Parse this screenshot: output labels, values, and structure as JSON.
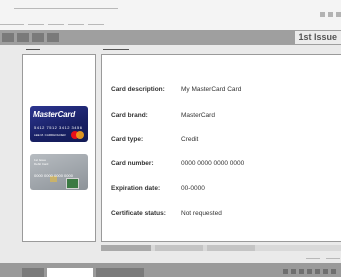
{
  "window": {
    "tab_label": "1st Issue"
  },
  "cards": [
    {
      "brand_logo_text": "MasterCard",
      "number_text": "5412 7512 3412 3456",
      "holder_text": "LEE M. CARDHOLDER",
      "expiry_text": "12/15"
    },
    {
      "issuer_text": "1st Issue",
      "subtitle_text": "Debit Card",
      "number_text": "0000 0000 0000 0000",
      "holder_text": "CARD HOLDER"
    }
  ],
  "details": {
    "rows": [
      {
        "label": "Card description:",
        "value": "My MasterCard Card"
      },
      {
        "label": "Card brand:",
        "value": "MasterCard"
      },
      {
        "label": "Card type:",
        "value": "Credit"
      },
      {
        "label": "Card number:",
        "value": "0000 0000 0000 0000"
      },
      {
        "label": "Expiration date:",
        "value": "00-0000"
      },
      {
        "label": "Certificate status:",
        "value": "Not requested"
      }
    ]
  },
  "colors": {
    "mastercard_blue": "#1f2a7a",
    "panel_border": "#9a9a9a",
    "toolbar_gray": "#9f9f9f"
  }
}
